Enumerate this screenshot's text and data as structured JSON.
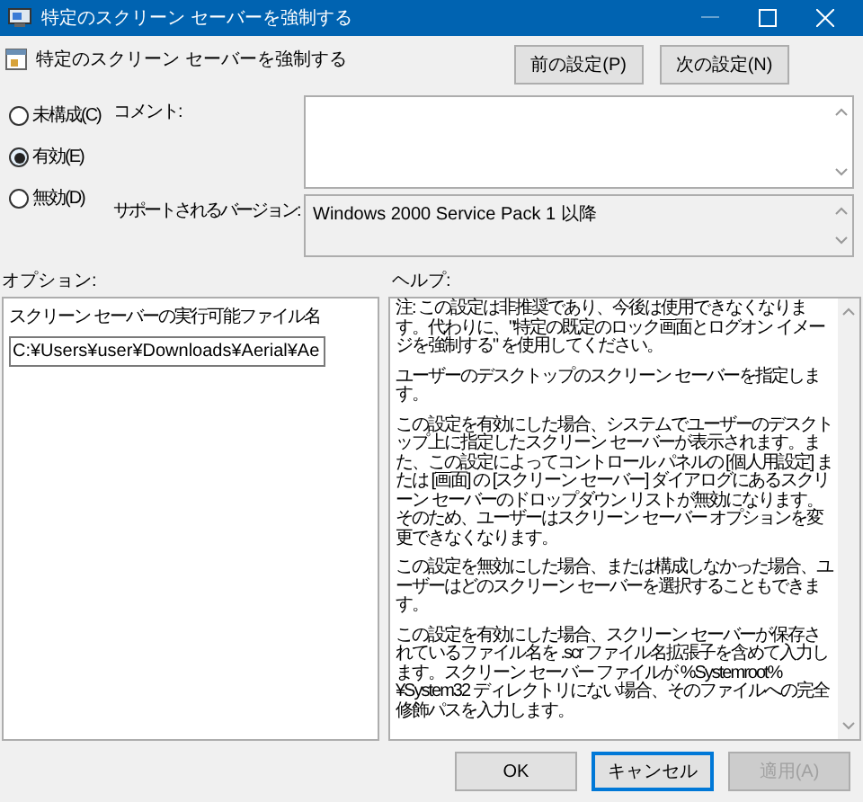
{
  "window": {
    "title": "特定のスクリーン セーバーを強制する"
  },
  "header": {
    "title": "特定のスクリーン セーバーを強制する",
    "buttons": [
      {
        "label": "前の設定(P)"
      },
      {
        "label": "次の設定(N)"
      }
    ]
  },
  "states": [
    {
      "label": "未構成(C)",
      "selected": false
    },
    {
      "label": "有効(E)",
      "selected": true
    },
    {
      "label": "無効(D)",
      "selected": false
    }
  ],
  "comment": {
    "label": "コメント:"
  },
  "supported": {
    "label": "サポートされるバージョン:",
    "value": "Windows 2000 Service Pack 1 以降"
  },
  "options": {
    "label": "オプション:",
    "field_label": "スクリーン セーバーの実行可能ファイル名",
    "field_value": "C:¥Users¥user¥Downloads¥Aerial¥Ae"
  },
  "help": {
    "label": "ヘルプ:",
    "paragraphs": [
      "注: この設定は非推奨であり、今後は使用できなくなります。代わりに、\"特定の既定のロック画面とログオン イメージを強制する\" を使用してください。",
      "ユーザーのデスクトップのスクリーン セーバーを指定します。",
      "この設定を有効にした場合、システムでユーザーのデスクトップ上に指定したスクリーン セーバーが表示されます。また、この設定によってコントロール パネルの [個人用設定] または [画面] の [スクリーン セーバー] ダイアログにあるスクリーン セーバーのドロップダウン リストが無効になります。そのため、ユーザーはスクリーン セーバー オプションを変更できなくなります。",
      "この設定を無効にした場合、または構成しなかった場合、ユーザーはどのスクリーン セーバーを選択することもできます。",
      "この設定を有効にした場合、スクリーン セーバーが保存されているファイル名を .scr ファイル名拡張子を含めて入力します。スクリーン セーバー ファイルが %Systemroot%¥System32 ディレクトリにない場合、そのファイルへの完全修飾パスを入力します。"
    ]
  },
  "footer": {
    "buttons": [
      {
        "label": "OK",
        "disabled": false,
        "selected": false
      },
      {
        "label": "キャンセル",
        "disabled": false,
        "selected": true
      },
      {
        "label": "適用(A)",
        "disabled": true,
        "selected": false
      }
    ]
  }
}
